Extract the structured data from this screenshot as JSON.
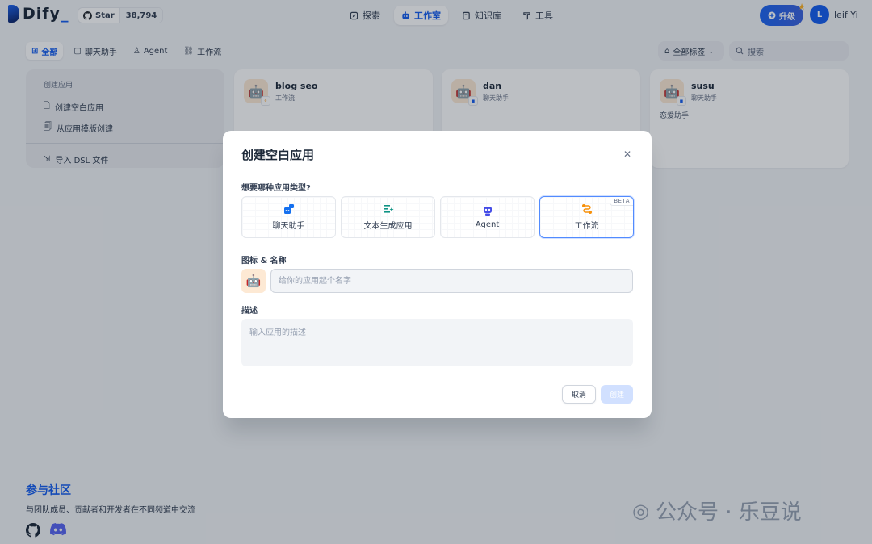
{
  "header": {
    "logo_text": "Dify",
    "github": {
      "star_label": "Star",
      "star_count": "38,794"
    },
    "nav": [
      {
        "label": "探索",
        "icon": "explore-icon"
      },
      {
        "label": "工作室",
        "icon": "robot-icon"
      },
      {
        "label": "知识库",
        "icon": "book-icon"
      },
      {
        "label": "工具",
        "icon": "tool-icon"
      }
    ],
    "active_nav": "工作室",
    "upgrade_label": "升级",
    "user": {
      "initial": "L",
      "name": "leif Yi"
    }
  },
  "filters": {
    "tabs": [
      {
        "label": "全部",
        "icon": "grid-icon"
      },
      {
        "label": "聊天助手",
        "icon": "chat-icon"
      },
      {
        "label": "Agent",
        "icon": "agent-icon"
      },
      {
        "label": "工作流",
        "icon": "workflow-icon"
      }
    ],
    "tag_filter_label": "全部标签",
    "search_placeholder": "搜索"
  },
  "create_card": {
    "title": "创建应用",
    "blank": "创建空白应用",
    "template": "从应用模版创建",
    "import": "导入 DSL 文件"
  },
  "apps": [
    {
      "name": "blog seo",
      "type": "工作流",
      "description": ""
    },
    {
      "name": "dan",
      "type": "聊天助手",
      "description": ""
    },
    {
      "name": "susu",
      "type": "聊天助手",
      "description": "恋爱助手"
    }
  ],
  "community": {
    "title": "参与社区",
    "subtitle": "与团队成员、贡献者和开发者在不同频道中交流"
  },
  "watermark": "公众号 · 乐豆说",
  "modal": {
    "title": "创建空白应用",
    "type_question": "想要哪种应用类型?",
    "types": [
      {
        "label": "聊天助手",
        "icon": "chat-assistant-icon",
        "color": "#1570ef"
      },
      {
        "label": "文本生成应用",
        "icon": "text-generation-icon",
        "color": "#0e9384"
      },
      {
        "label": "Agent",
        "icon": "agent-robot-icon",
        "color": "#444ce7"
      },
      {
        "label": "工作流",
        "icon": "workflow-icon",
        "color": "#f79009"
      }
    ],
    "selected_type": "工作流",
    "beta_badge": "BETA",
    "name_label": "图标 & 名称",
    "name_placeholder": "给你的应用起个名字",
    "desc_label": "描述",
    "desc_placeholder": "输入应用的描述",
    "cancel_label": "取消",
    "create_label": "创建"
  },
  "colors": {
    "primary": "#155eef",
    "background": "#f2f4f7",
    "create_disabled": "#d1e0ff"
  }
}
